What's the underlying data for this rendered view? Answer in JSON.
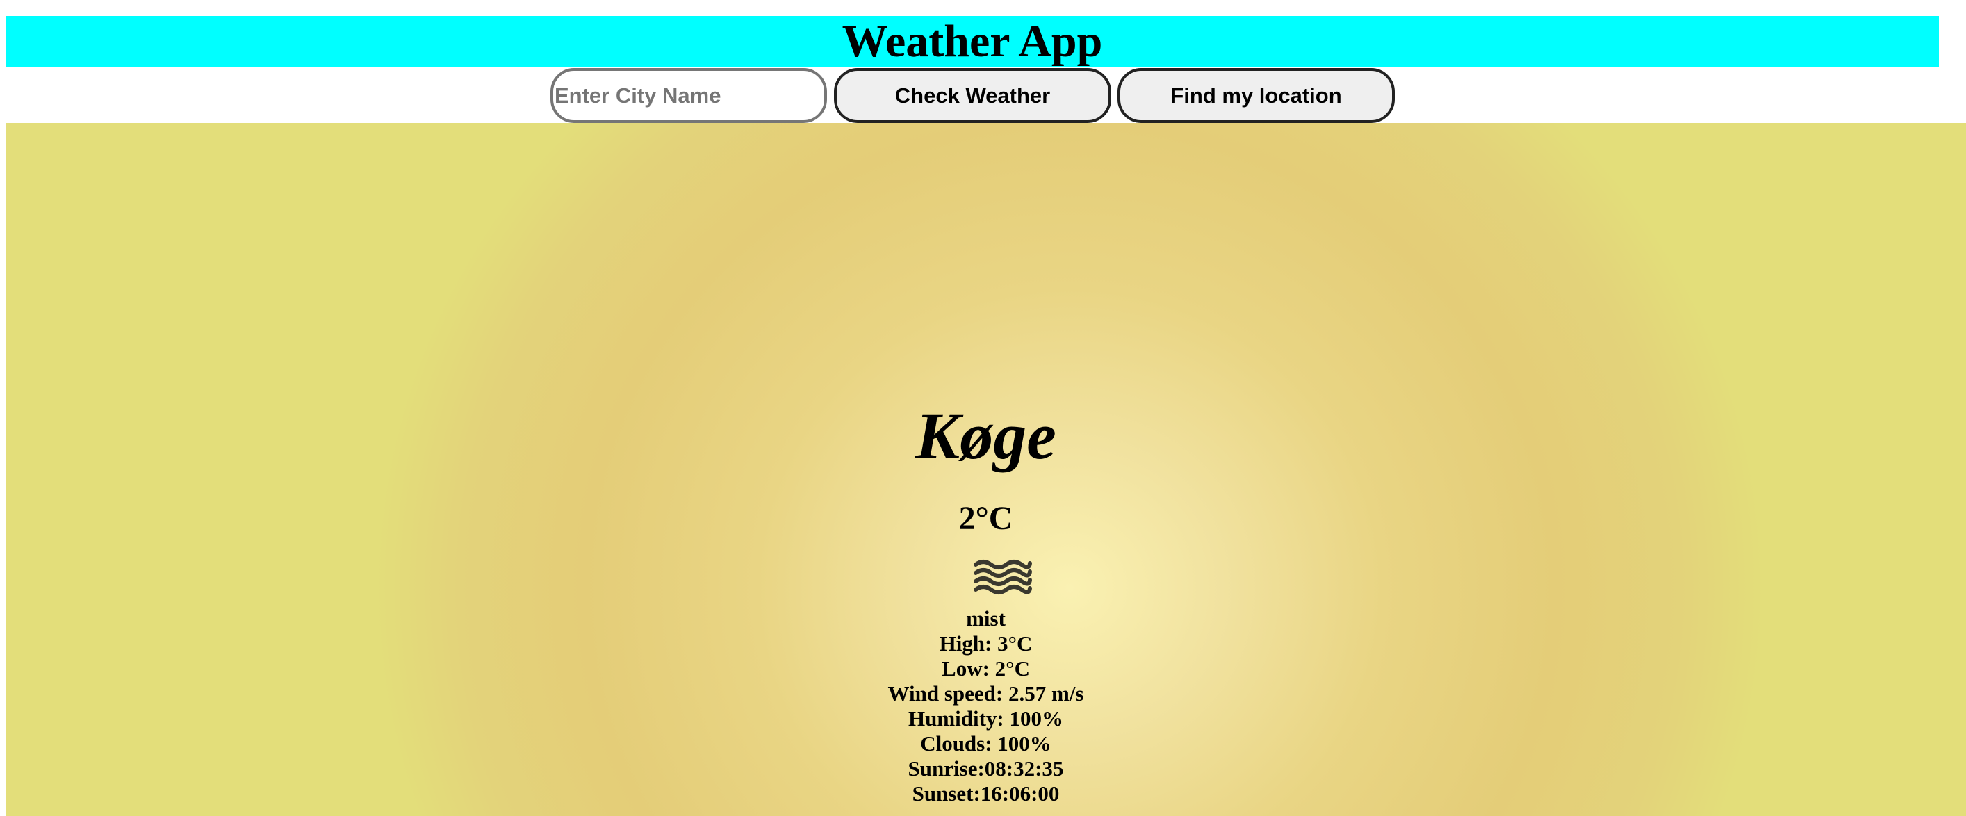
{
  "header": {
    "title": "Weather App"
  },
  "controls": {
    "city_placeholder": "Enter City Name",
    "city_value": "",
    "check_label": "Check Weather",
    "locate_label": "Find my location"
  },
  "weather": {
    "city": "Køge",
    "temperature": "2°C",
    "icon": "mist-icon",
    "description": "mist",
    "high": "High: 3°C",
    "low": "Low: 2°C",
    "wind": "Wind speed: 2.57 m/s",
    "humidity": "Humidity: 100%",
    "clouds": "Clouds: 100%",
    "sunrise": "Sunrise:08:32:35",
    "sunset": "Sunset:16:06:00"
  },
  "colors": {
    "header_bg": "#00ffff",
    "panel_center": "#faf1b2",
    "panel_edge": "#e3d37a"
  }
}
